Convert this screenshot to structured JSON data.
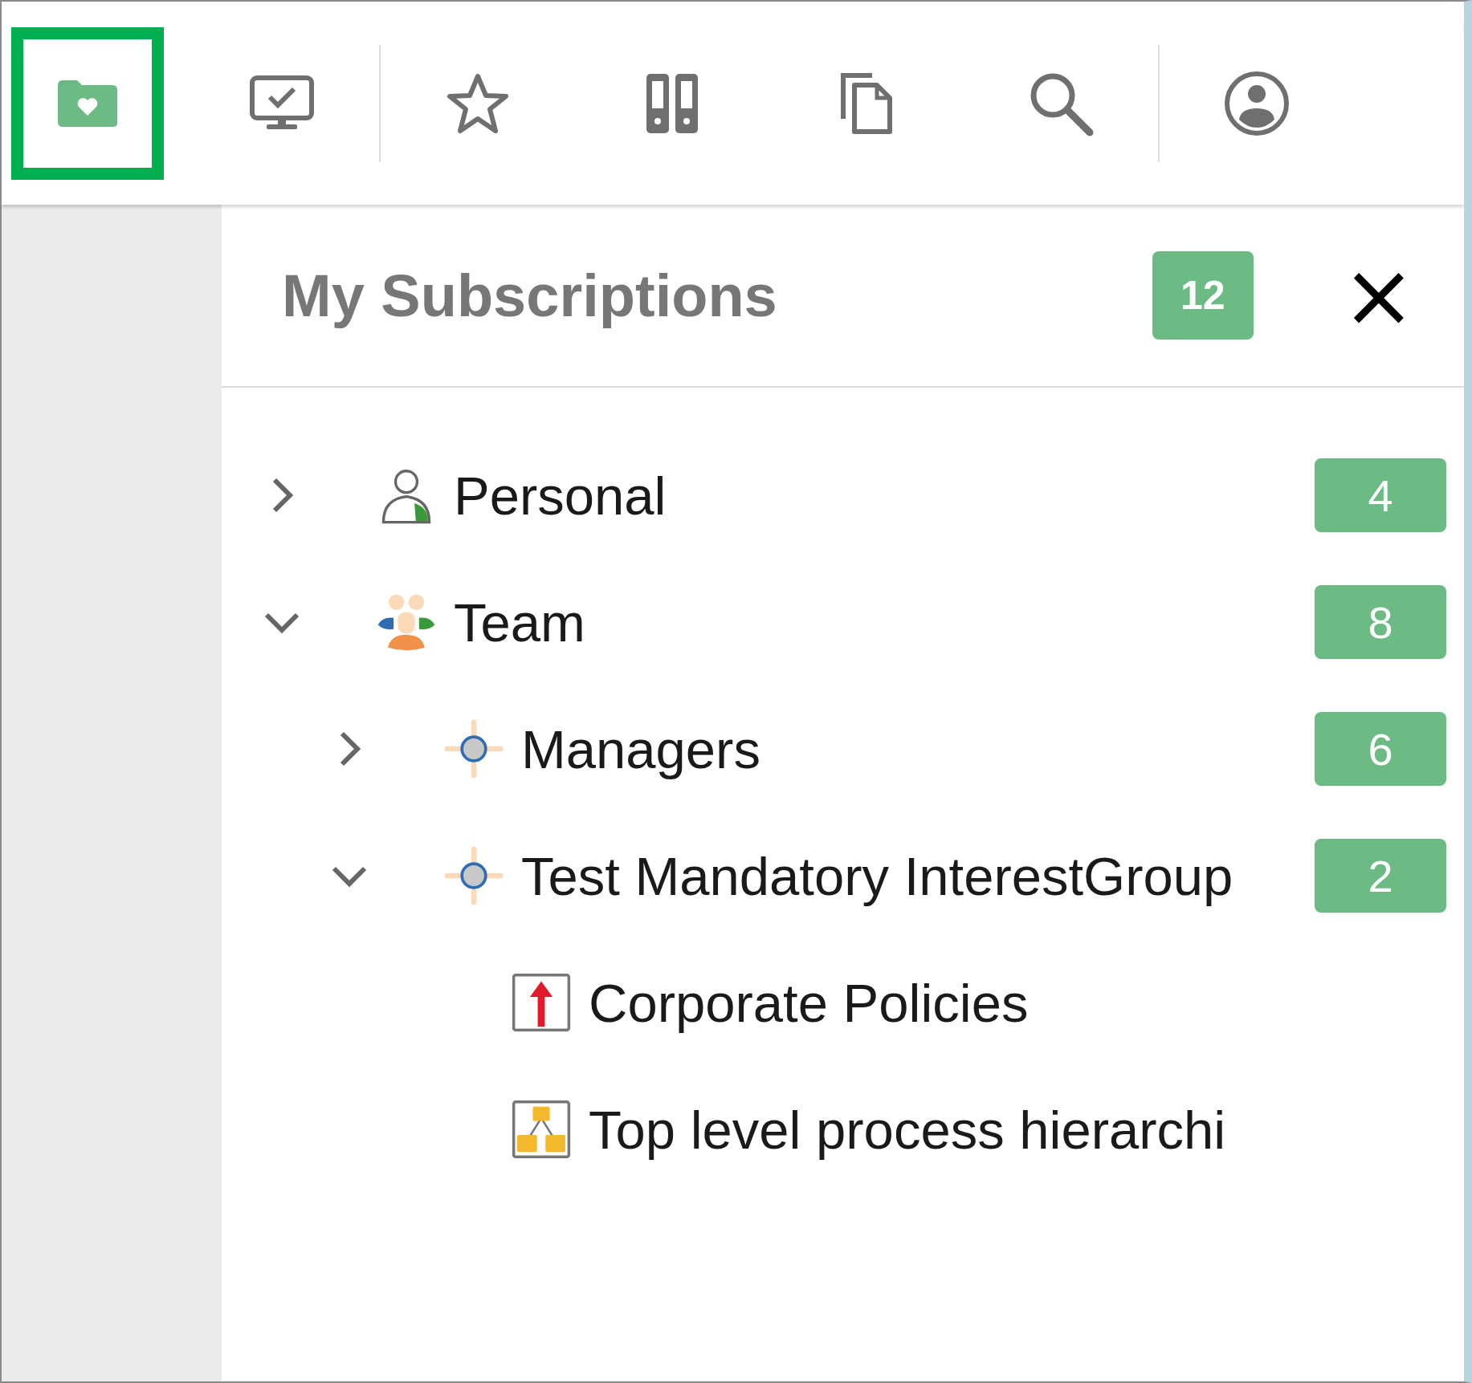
{
  "toolbar": {
    "groups": [
      {
        "items": [
          {
            "kind": "folder-heart",
            "selected": true
          },
          {
            "kind": "monitor-check",
            "selected": false
          }
        ]
      },
      {
        "items": [
          {
            "kind": "star",
            "selected": false
          },
          {
            "kind": "binders",
            "selected": false
          },
          {
            "kind": "copy",
            "selected": false
          },
          {
            "kind": "search",
            "selected": false
          }
        ]
      },
      {
        "items": [
          {
            "kind": "user",
            "selected": false
          }
        ]
      }
    ]
  },
  "panel": {
    "title": "My Subscriptions",
    "count": "12",
    "close": "×"
  },
  "tree": [
    {
      "label": "Personal",
      "count": "4",
      "kind": "person",
      "expanded": false
    },
    {
      "label": "Team",
      "count": "8",
      "kind": "team",
      "expanded": true,
      "children": [
        {
          "label": "Managers",
          "count": "6",
          "kind": "group",
          "expanded": false
        },
        {
          "label": "Test Mandatory InterestGroup",
          "count": "2",
          "kind": "group",
          "expanded": true,
          "children": [
            {
              "label": "Corporate Policies",
              "kind": "policy"
            },
            {
              "label": "Top level process hierarchi",
              "kind": "hierarchy"
            }
          ]
        }
      ]
    }
  ]
}
